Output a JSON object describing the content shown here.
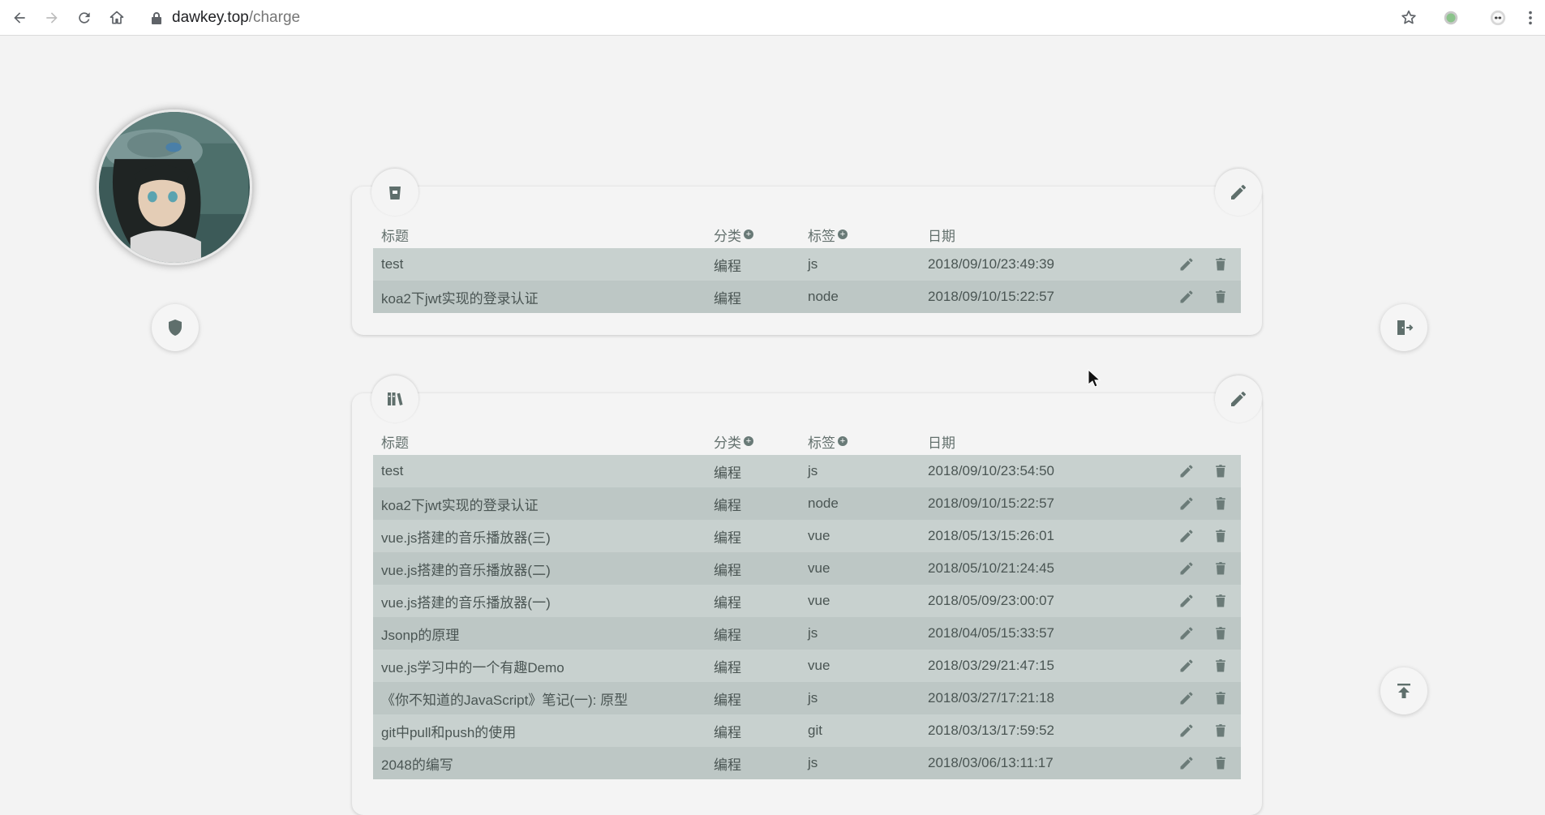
{
  "browser": {
    "url_host": "dawkey.top",
    "url_path": "/charge"
  },
  "table_headers": {
    "title": "标题",
    "category": "分类",
    "tag": "标签",
    "date": "日期"
  },
  "drafts": {
    "icon": "trash-bin-icon",
    "rows": [
      {
        "title": "test",
        "category": "编程",
        "tag": "js",
        "date": "2018/09/10/23:49:39"
      },
      {
        "title": "koa2下jwt实现的登录认证",
        "category": "编程",
        "tag": "node",
        "date": "2018/09/10/15:22:57"
      }
    ]
  },
  "articles": {
    "icon": "books-icon",
    "rows": [
      {
        "title": "test",
        "category": "编程",
        "tag": "js",
        "date": "2018/09/10/23:54:50"
      },
      {
        "title": "koa2下jwt实现的登录认证",
        "category": "编程",
        "tag": "node",
        "date": "2018/09/10/15:22:57"
      },
      {
        "title": "vue.js搭建的音乐播放器(三)",
        "category": "编程",
        "tag": "vue",
        "date": "2018/05/13/15:26:01"
      },
      {
        "title": "vue.js搭建的音乐播放器(二)",
        "category": "编程",
        "tag": "vue",
        "date": "2018/05/10/21:24:45"
      },
      {
        "title": "vue.js搭建的音乐播放器(一)",
        "category": "编程",
        "tag": "vue",
        "date": "2018/05/09/23:00:07"
      },
      {
        "title": "Jsonp的原理",
        "category": "编程",
        "tag": "js",
        "date": "2018/04/05/15:33:57"
      },
      {
        "title": "vue.js学习中的一个有趣Demo",
        "category": "编程",
        "tag": "vue",
        "date": "2018/03/29/21:47:15"
      },
      {
        "title": "《你不知道的JavaScript》笔记(一): 原型",
        "category": "编程",
        "tag": "js",
        "date": "2018/03/27/17:21:18"
      },
      {
        "title": "git中pull和push的使用",
        "category": "编程",
        "tag": "git",
        "date": "2018/03/13/17:59:52"
      },
      {
        "title": "2048的编写",
        "category": "编程",
        "tag": "js",
        "date": "2018/03/06/13:11:17"
      }
    ]
  },
  "colors": {
    "icon": "#5f6f6c",
    "row_odd": "#c8d1cf",
    "row_even": "#bdc7c5",
    "background": "#f3f3f3"
  }
}
